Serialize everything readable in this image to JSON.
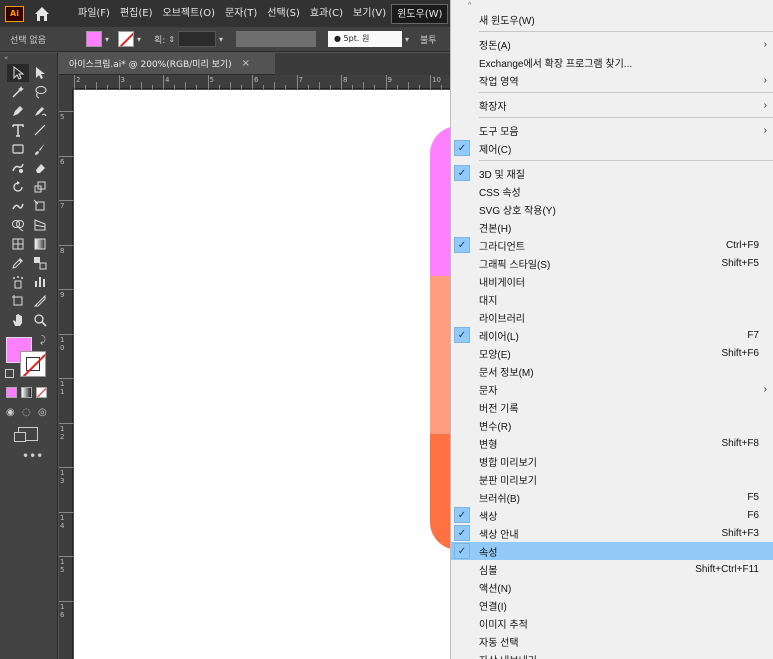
{
  "app": {
    "logo_text": "Ai",
    "menus": [
      "파일(F)",
      "편집(E)",
      "오브젝트(O)",
      "문자(T)",
      "선택(S)",
      "효과(C)",
      "보기(V)",
      "윈도우(W)"
    ],
    "active_menu": "윈도우(W)"
  },
  "control_bar": {
    "selection_label": "선택 없음",
    "stroke_label": "획:",
    "point_label": "5pt. 원",
    "tail_label": "불투"
  },
  "colors": {
    "fill": "#ff80ff",
    "stripes": [
      "#ff80ff",
      "#ff9d80",
      "#ff7142"
    ]
  },
  "document_tab": {
    "title": "아이스크림.ai* @ 200%(RGB/미리 보기)",
    "close_glyph": "×"
  },
  "ruler": {
    "top": [
      "2",
      "3",
      "4",
      "5",
      "6",
      "7",
      "8",
      "9",
      "10"
    ],
    "left": [
      "5",
      "6",
      "7",
      "8",
      "9",
      "1 0",
      "1 1",
      "1 2",
      "1 3",
      "1 4",
      "1 5",
      "1 6"
    ]
  },
  "window_menu": {
    "scroll_up_glyph": "^",
    "items": [
      {
        "type": "item",
        "label": "새 윈도우(W)"
      },
      {
        "type": "sep"
      },
      {
        "type": "item",
        "label": "정돈(A)",
        "submenu": true
      },
      {
        "type": "item",
        "label": "Exchange에서 확장 프로그램 찾기..."
      },
      {
        "type": "item",
        "label": "작업 영역",
        "submenu": true
      },
      {
        "type": "sep"
      },
      {
        "type": "item",
        "label": "확장자",
        "submenu": true
      },
      {
        "type": "sep"
      },
      {
        "type": "item",
        "label": "도구 모음",
        "submenu": true
      },
      {
        "type": "item",
        "label": "제어(C)",
        "checked": true
      },
      {
        "type": "sep"
      },
      {
        "type": "item",
        "label": "3D 및 재질",
        "checked": true
      },
      {
        "type": "item",
        "label": "CSS 속성"
      },
      {
        "type": "item",
        "label": "SVG 상호 작용(Y)"
      },
      {
        "type": "item",
        "label": "견본(H)"
      },
      {
        "type": "item",
        "label": "그라디언트",
        "checked": true,
        "shortcut": "Ctrl+F9"
      },
      {
        "type": "item",
        "label": "그래픽 스타일(S)",
        "shortcut": "Shift+F5"
      },
      {
        "type": "item",
        "label": "내비게이터"
      },
      {
        "type": "item",
        "label": "대지"
      },
      {
        "type": "item",
        "label": "라이브러리"
      },
      {
        "type": "item",
        "label": "레이어(L)",
        "checked": true,
        "shortcut": "F7"
      },
      {
        "type": "item",
        "label": "모양(E)",
        "shortcut": "Shift+F6"
      },
      {
        "type": "item",
        "label": "문서 정보(M)"
      },
      {
        "type": "item",
        "label": "문자",
        "submenu": true
      },
      {
        "type": "item",
        "label": "버전 기록"
      },
      {
        "type": "item",
        "label": "변수(R)"
      },
      {
        "type": "item",
        "label": "변형",
        "shortcut": "Shift+F8"
      },
      {
        "type": "item",
        "label": "병합 미리보기"
      },
      {
        "type": "item",
        "label": "분판 미리보기"
      },
      {
        "type": "item",
        "label": "브러쉬(B)",
        "shortcut": "F5"
      },
      {
        "type": "item",
        "label": "색상",
        "checked": true,
        "shortcut": "F6"
      },
      {
        "type": "item",
        "label": "색상 안내",
        "checked": true,
        "shortcut": "Shift+F3"
      },
      {
        "type": "item",
        "label": "속성",
        "checked": true,
        "highlighted": true
      },
      {
        "type": "item",
        "label": "심볼",
        "shortcut": "Shift+Ctrl+F11"
      },
      {
        "type": "item",
        "label": "액션(N)"
      },
      {
        "type": "item",
        "label": "연결(I)"
      },
      {
        "type": "item",
        "label": "이미지 추적"
      },
      {
        "type": "item",
        "label": "자동 선택"
      },
      {
        "type": "item",
        "label": "자산 내보내기"
      }
    ]
  }
}
